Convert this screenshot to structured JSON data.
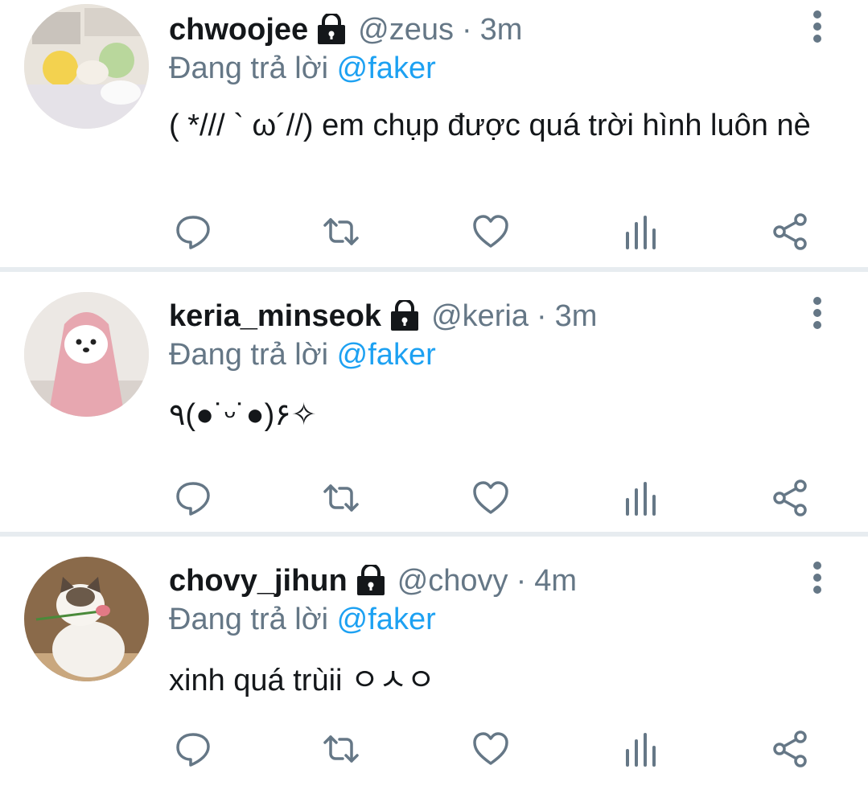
{
  "tweets": [
    {
      "name": "chwoojee",
      "handle": "@zeus",
      "separator": "·",
      "time": "3m",
      "replying_prefix": "Đang trả lời",
      "replying_to": "@faker",
      "text": "( */// ` ω´//) em chụp được quá trời hình luôn nè"
    },
    {
      "name": "keria_minseok",
      "handle": "@keria",
      "separator": "·",
      "time": "3m",
      "replying_prefix": "Đang trả lời",
      "replying_to": "@faker",
      "text": "٩(●˙ᵕ˙●)۶✧"
    },
    {
      "name": "chovy_jihun",
      "handle": "@chovy",
      "separator": "·",
      "time": "4m",
      "replying_prefix": "Đang trả lời",
      "replying_to": "@faker",
      "text": "xinh quá trùii ㅇㅅㅇ"
    }
  ],
  "icons": {
    "lock": "lock-icon",
    "more": "more-vertical-icon",
    "reply": "reply-icon",
    "retweet": "retweet-icon",
    "like": "heart-icon",
    "stats": "stats-icon",
    "share": "share-icon"
  },
  "colors": {
    "text": "#14171a",
    "secondary": "#657786",
    "mention": "#1da1f2",
    "separator": "#e7ecf0"
  }
}
